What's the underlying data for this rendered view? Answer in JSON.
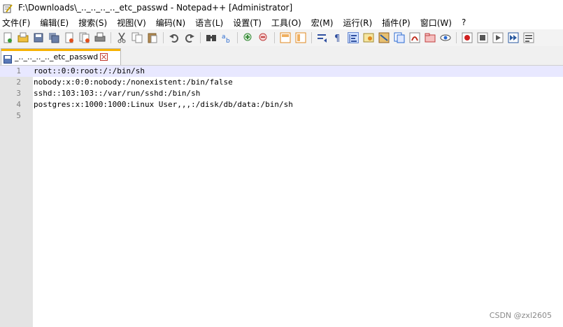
{
  "window": {
    "title": "F:\\Downloads\\_.._.._.._.._etc_passwd - Notepad++ [Administrator]"
  },
  "menu": [
    "文件(F)",
    "编辑(E)",
    "搜索(S)",
    "视图(V)",
    "编码(N)",
    "语言(L)",
    "设置(T)",
    "工具(O)",
    "宏(M)",
    "运行(R)",
    "插件(P)",
    "窗口(W)",
    "?"
  ],
  "toolbar": {
    "icons": [
      "new-file-icon",
      "open-file-icon",
      "save-icon",
      "save-all-icon",
      "close-icon",
      "close-all-icon",
      "print-icon",
      "cut-icon",
      "copy-icon",
      "paste-icon",
      "undo-icon",
      "redo-icon",
      "find-icon",
      "replace-icon",
      "zoom-in-icon",
      "zoom-out-icon",
      "sync-vertical-icon",
      "sync-horizontal-icon",
      "word-wrap-icon",
      "show-all-chars-icon",
      "indent-guide-icon",
      "user-language-icon",
      "doc-map-icon",
      "function-list-icon",
      "folder-workspace-icon",
      "monitoring-icon",
      "record-macro-icon",
      "stop-macro-icon",
      "play-macro-icon",
      "run-macro-multiple-icon",
      "save-macro-icon"
    ]
  },
  "tab": {
    "label": "_.._.._.._.._etc_passwd"
  },
  "editor": {
    "current_line": 1,
    "lines": [
      {
        "n": "1",
        "text": "root::0:0:root:/:/bin/sh"
      },
      {
        "n": "2",
        "text": "nobody:x:0:0:nobody:/nonexistent:/bin/false"
      },
      {
        "n": "3",
        "text": "sshd::103:103::/var/run/sshd:/bin/sh"
      },
      {
        "n": "4",
        "text": "postgres:x:1000:1000:Linux User,,,:/disk/db/data:/bin/sh"
      },
      {
        "n": "5",
        "text": ""
      }
    ]
  },
  "watermark": "CSDN @zxl2605",
  "colors": {
    "tab_accent": "#f7b100",
    "current_line": "#e8e8ff",
    "gutter": "#e4e4e4"
  }
}
